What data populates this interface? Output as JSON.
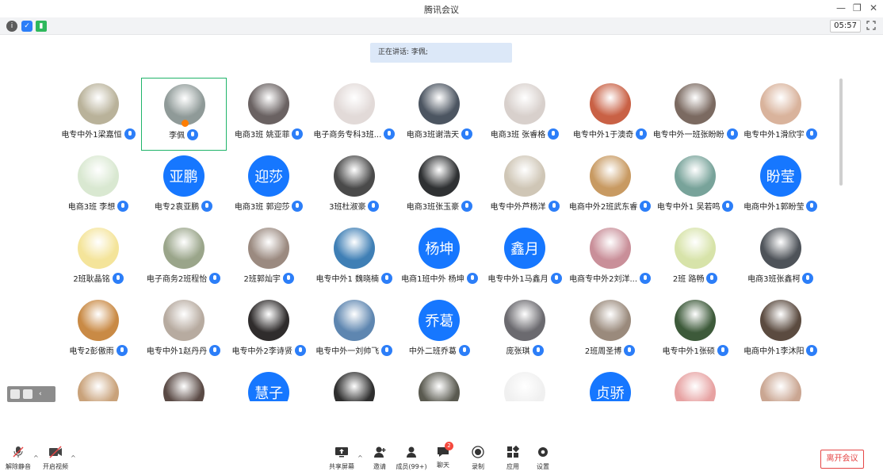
{
  "window": {
    "title": "腾讯会议"
  },
  "topbar": {
    "clock": "05:57"
  },
  "speaking": {
    "label": "正在讲话: 李佩;"
  },
  "participants": [
    {
      "name": "电专中外1梁嘉恒",
      "avatar": "photo",
      "color": "#b9b29a"
    },
    {
      "name": "李佩",
      "avatar": "photo",
      "color": "#8f9a98",
      "active": true
    },
    {
      "name": "电商3班 姚亚菲",
      "avatar": "photo",
      "color": "#6a6262"
    },
    {
      "name": "电子商务专科3班...",
      "avatar": "photo",
      "color": "#e2dad8"
    },
    {
      "name": "电商3班谢浩天",
      "avatar": "photo",
      "color": "#4c5561"
    },
    {
      "name": "电商3班 张睿格",
      "avatar": "photo",
      "color": "#d8d0cc"
    },
    {
      "name": "电专中外1于澳奇",
      "avatar": "photo",
      "color": "#c96145"
    },
    {
      "name": "电专中外一班张盼盼",
      "avatar": "photo",
      "color": "#7b6a61"
    },
    {
      "name": "电专中外1滑欣宇",
      "avatar": "photo",
      "color": "#d9b39c"
    },
    {
      "name": "电商3班 李想",
      "avatar": "photo",
      "color": "#d9e8d1"
    },
    {
      "name": "电专2袁亚鹏",
      "avatar": "text",
      "text": "亚鹏"
    },
    {
      "name": "电商3班 郭迎莎",
      "avatar": "text",
      "text": "迎莎"
    },
    {
      "name": "3班杜淑豪",
      "avatar": "photo",
      "color": "#4a4a4a"
    },
    {
      "name": "电商3班张玉豪",
      "avatar": "photo",
      "color": "#2f3133"
    },
    {
      "name": "电专中外芦杨洋",
      "avatar": "photo",
      "color": "#cfc6b6"
    },
    {
      "name": "电商中外2班武东睿",
      "avatar": "photo",
      "color": "#c89a62"
    },
    {
      "name": "电专中外1 吴若鸣",
      "avatar": "photo",
      "color": "#78a39a"
    },
    {
      "name": "电商中外1郭盼莹",
      "avatar": "text",
      "text": "盼莹"
    },
    {
      "name": "2班耿晶铭",
      "avatar": "photo",
      "color": "#f4e49a"
    },
    {
      "name": "电子商务2班程怡",
      "avatar": "photo",
      "color": "#9aa58a"
    },
    {
      "name": "2班郭灿宇",
      "avatar": "photo",
      "color": "#9b8a80"
    },
    {
      "name": "电专中外1 魏晓楠",
      "avatar": "photo",
      "color": "#3f7fb5"
    },
    {
      "name": "电商1班中外 杨坤",
      "avatar": "text",
      "text": "杨坤"
    },
    {
      "name": "电专中外1马鑫月",
      "avatar": "text",
      "text": "鑫月"
    },
    {
      "name": "电商专中外2刘洋...",
      "avatar": "photo",
      "color": "#c98f99"
    },
    {
      "name": "2班 路畅",
      "avatar": "photo",
      "color": "#d7e3a9"
    },
    {
      "name": "电商3班张鑫柯",
      "avatar": "photo",
      "color": "#4e5359"
    },
    {
      "name": "电专2彭傲雨",
      "avatar": "photo",
      "color": "#c98a45"
    },
    {
      "name": "电专中外1赵丹丹",
      "avatar": "photo",
      "color": "#b7aba0"
    },
    {
      "name": "电专中外2李诗贤",
      "avatar": "photo",
      "color": "#2f2c2c"
    },
    {
      "name": "电专中外一刘帅飞",
      "avatar": "photo",
      "color": "#5e86b0"
    },
    {
      "name": "中外二班乔葛",
      "avatar": "text",
      "text": "乔葛"
    },
    {
      "name": "庞张琪",
      "avatar": "photo",
      "color": "#6b6a6f"
    },
    {
      "name": "2班周圣博",
      "avatar": "photo",
      "color": "#9a8a7c"
    },
    {
      "name": "电专中外1张硕",
      "avatar": "photo",
      "color": "#3d5a3a"
    },
    {
      "name": "电商中外1李沐阳",
      "avatar": "photo",
      "color": "#5b4b40"
    },
    {
      "name": "",
      "avatar": "photo",
      "color": "#c9a27a"
    },
    {
      "name": "",
      "avatar": "photo",
      "color": "#5a4a45"
    },
    {
      "name": "",
      "avatar": "text",
      "text": "慧子"
    },
    {
      "name": "",
      "avatar": "photo",
      "color": "#2e2e2e"
    },
    {
      "name": "",
      "avatar": "photo",
      "color": "#5a5a50"
    },
    {
      "name": "",
      "avatar": "photo",
      "color": "#f0f0f0"
    },
    {
      "name": "",
      "avatar": "text",
      "text": "贞骄"
    },
    {
      "name": "",
      "avatar": "photo",
      "color": "#e7a2a2"
    },
    {
      "name": "",
      "avatar": "photo",
      "color": "#caa692"
    }
  ],
  "toolbar": {
    "unmute": "解除静音",
    "start_video": "开启视频",
    "share_screen": "共享屏幕",
    "invite": "邀请",
    "members": "成员(99+)",
    "chat": "聊天",
    "chat_badge": "2",
    "record": "录制",
    "apps": "应用",
    "settings": "设置",
    "leave": "离开会议"
  }
}
